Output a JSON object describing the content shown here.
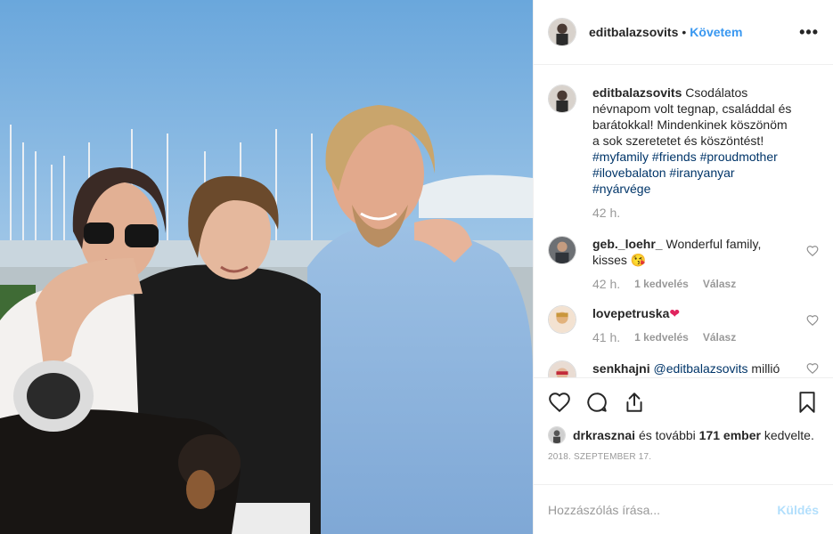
{
  "post": {
    "username": "editbalazsovits",
    "follow_label": "Követem",
    "dot": "•",
    "more_label": "•••"
  },
  "caption": {
    "username": "editbalazsovits",
    "text": "Csodálatos névnapom volt tegnap, családdal és barátokkal! Mindenkinek köszönöm a sok szeretetet és köszöntést!",
    "tags": [
      "#myfamily",
      "#friends",
      "#proudmother",
      "#ilovebalaton",
      "#iranyanyar",
      "#nyárvége"
    ],
    "time": "42 h."
  },
  "comments": [
    {
      "username": "geb._loehr_",
      "text": "Wonderful family, kisses",
      "emoji": "😘",
      "time": "42 h.",
      "likes": "1 kedvelés",
      "reply": "Válasz"
    },
    {
      "username": "lovepetruska",
      "text": "",
      "emoji": "❤",
      "time": "41 h.",
      "likes": "1 kedvelés",
      "reply": "Válasz"
    },
    {
      "username": "senkhajni",
      "mention": "@editbalazsovits",
      "text": "millió puszi Nektek",
      "emoji": "❣😍😘",
      "time": "",
      "likes": "",
      "reply": ""
    }
  ],
  "liked_by": {
    "user": "drkrasznai",
    "rest_prefix": "és további",
    "count": "171 ember",
    "suffix": "kedvelte."
  },
  "date": "2018. SZEPTEMBER 17.",
  "add_comment": {
    "placeholder": "Hozzászólás írása...",
    "post_label": "Küldés"
  },
  "icons": {
    "like": "heart-icon",
    "comment": "comment-icon",
    "share": "share-icon",
    "save": "bookmark-icon",
    "comment_like": "heart-outline-icon"
  },
  "colors": {
    "link": "#3897f0",
    "hashtag": "#003569",
    "muted": "#999999",
    "post_disabled": "#b2dffc"
  }
}
